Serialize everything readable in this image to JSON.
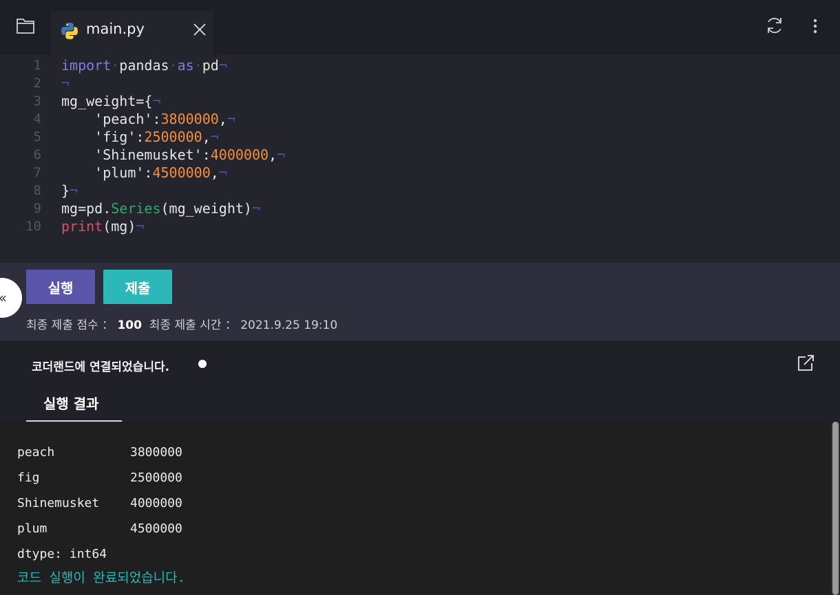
{
  "tab": {
    "filename": "main.py"
  },
  "editor": {
    "lines": [
      {
        "n": "1",
        "parts": [
          [
            "kw",
            "import"
          ],
          [
            "dot",
            "·"
          ],
          [
            "",
            "pandas"
          ],
          [
            "dot",
            "·"
          ],
          [
            "kw",
            "as"
          ],
          [
            "dot",
            "·"
          ],
          [
            "",
            "pd"
          ],
          [
            "nl",
            "¬"
          ]
        ]
      },
      {
        "n": "2",
        "parts": [
          [
            "nl",
            "¬"
          ]
        ]
      },
      {
        "n": "3",
        "parts": [
          [
            "",
            "mg_weight={"
          ],
          [
            "nl",
            "¬"
          ]
        ]
      },
      {
        "n": "4",
        "parts": [
          [
            "",
            "    'peach':"
          ],
          [
            "num",
            "3800000"
          ],
          [
            "",
            ","
          ],
          [
            "nl",
            "¬"
          ]
        ]
      },
      {
        "n": "5",
        "parts": [
          [
            "",
            "    'fig':"
          ],
          [
            "num",
            "2500000"
          ],
          [
            "",
            ","
          ],
          [
            "nl",
            "¬"
          ]
        ]
      },
      {
        "n": "6",
        "parts": [
          [
            "",
            "    'Shinemusket':"
          ],
          [
            "num",
            "4000000"
          ],
          [
            "",
            ","
          ],
          [
            "nl",
            "¬"
          ]
        ]
      },
      {
        "n": "7",
        "parts": [
          [
            "",
            "    'plum':"
          ],
          [
            "num",
            "4500000"
          ],
          [
            "",
            ","
          ],
          [
            "nl",
            "¬"
          ]
        ]
      },
      {
        "n": "8",
        "parts": [
          [
            "",
            "}"
          ],
          [
            "nl",
            "¬"
          ]
        ]
      },
      {
        "n": "9",
        "parts": [
          [
            "",
            "mg=pd."
          ],
          [
            "fn",
            "Series"
          ],
          [
            "",
            "(mg_weight)"
          ],
          [
            "nl",
            "¬"
          ]
        ]
      },
      {
        "n": "10",
        "parts": [
          [
            "pr",
            "print"
          ],
          [
            "",
            "(mg)"
          ],
          [
            "nl",
            "¬"
          ]
        ]
      }
    ]
  },
  "actions": {
    "run_label": "실행",
    "submit_label": "제출",
    "collapse_glyph": "«",
    "score_label": "최종 제출 점수 ： ",
    "score_value": "100",
    "time_label": "  최종 제출 시간 ： ",
    "time_value": "2021.9.25 19:10"
  },
  "connection": {
    "status_text": "코더랜드에 연결되었습니다."
  },
  "result": {
    "tab_label": "실행 결과",
    "rows": [
      {
        "name": "peach",
        "value": "3800000"
      },
      {
        "name": "fig",
        "value": "2500000"
      },
      {
        "name": "Shinemusket",
        "value": "4000000"
      },
      {
        "name": "plum",
        "value": "4500000"
      }
    ],
    "dtype_line": "dtype: int64",
    "done_text": "코드 실행이 완료되었습니다."
  },
  "icons": {
    "folder": "folder-icon",
    "python": "python-icon",
    "close": "close-icon",
    "refresh": "refresh-icon",
    "more": "kebab-menu-icon",
    "external": "external-link-icon"
  }
}
